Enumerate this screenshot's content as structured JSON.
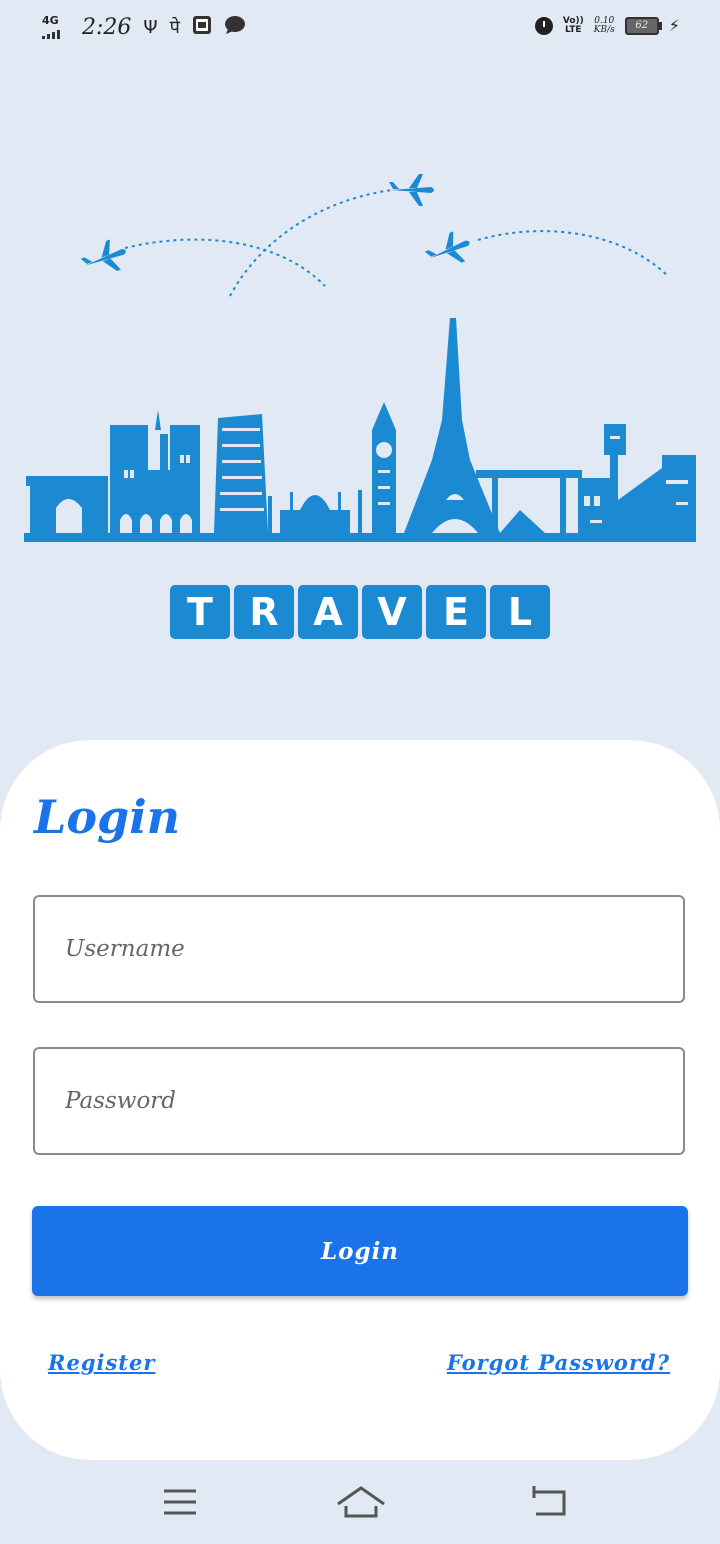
{
  "status_bar": {
    "network": "4G",
    "time": "2:26",
    "volte_top": "Vo))",
    "volte_bottom": "LTE",
    "speed_value": "0.10",
    "speed_unit": "KB/s",
    "battery": "62"
  },
  "brand": {
    "letters": [
      "T",
      "R",
      "A",
      "V",
      "E",
      "L"
    ],
    "color": "#1b8ad3"
  },
  "login": {
    "title": "Login",
    "username_placeholder": "Username",
    "password_placeholder": "Password",
    "button_label": "Login",
    "register_label": "Register",
    "forgot_label": "Forgot Password?",
    "accent": "#1a73e8"
  },
  "nav": {
    "items": [
      "menu-icon",
      "home-icon",
      "back-icon"
    ]
  }
}
